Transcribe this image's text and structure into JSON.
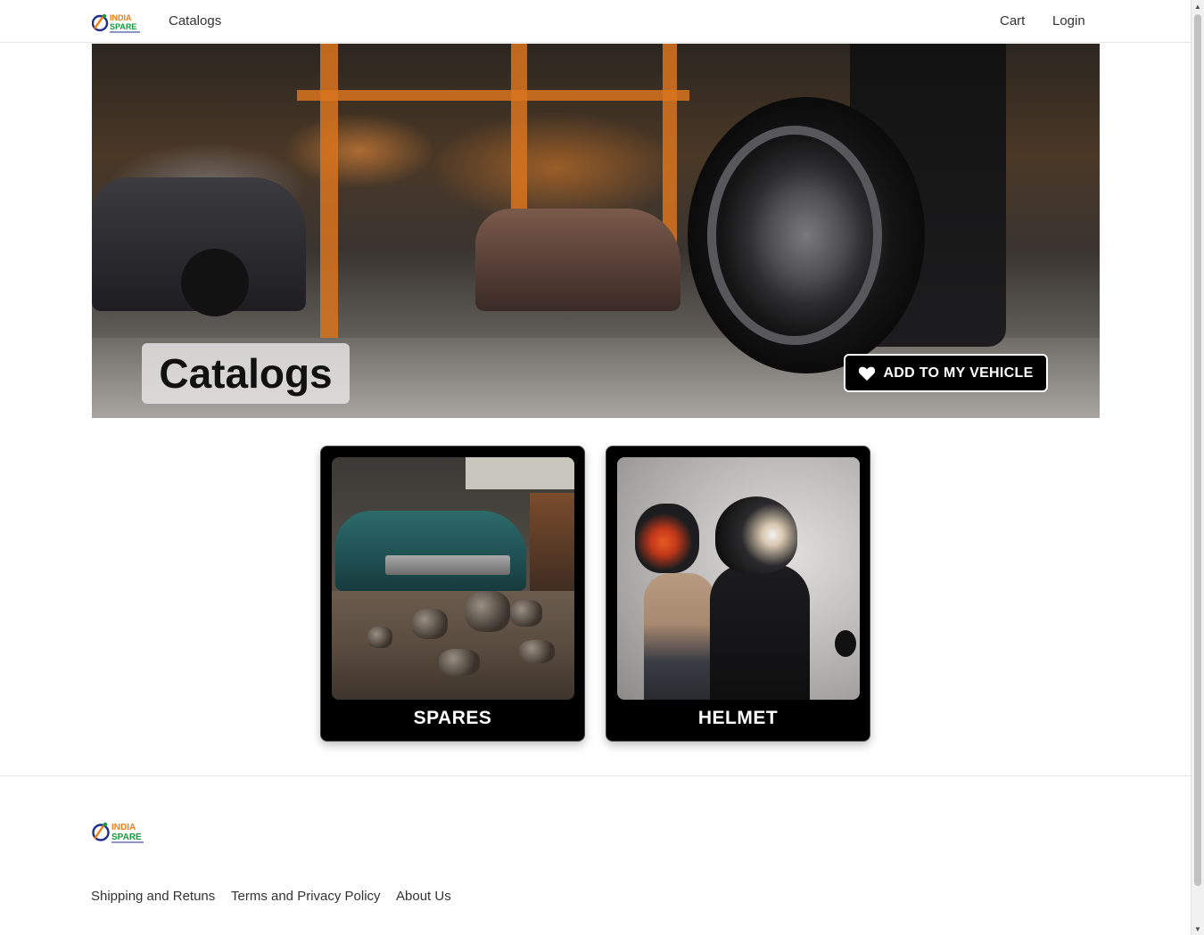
{
  "header": {
    "logo_icon": "india-spare-logo-icon",
    "logo_line1": "INDIA",
    "logo_line2": "SPARE",
    "nav_catalogs": "Catalogs",
    "nav_cart": "Cart",
    "nav_login": "Login"
  },
  "hero": {
    "title": "Catalogs",
    "add_vehicle_label": "ADD TO MY VEHICLE",
    "add_vehicle_icon": "heart-icon"
  },
  "catalogs": [
    {
      "label": "SPARES",
      "image": "spares-workshop-image"
    },
    {
      "label": "HELMET",
      "image": "riders-with-helmets-image"
    }
  ],
  "footer": {
    "logo_line1": "INDIA",
    "logo_line2": "SPARE",
    "links": [
      "Shipping and Retuns",
      "Terms and Privacy Policy",
      "About Us"
    ]
  },
  "colors": {
    "brand_orange": "#f07d12",
    "brand_green": "#159a3c",
    "brand_blue": "#1f2e8c",
    "card_bg": "#000000",
    "button_bg": "#000000"
  }
}
